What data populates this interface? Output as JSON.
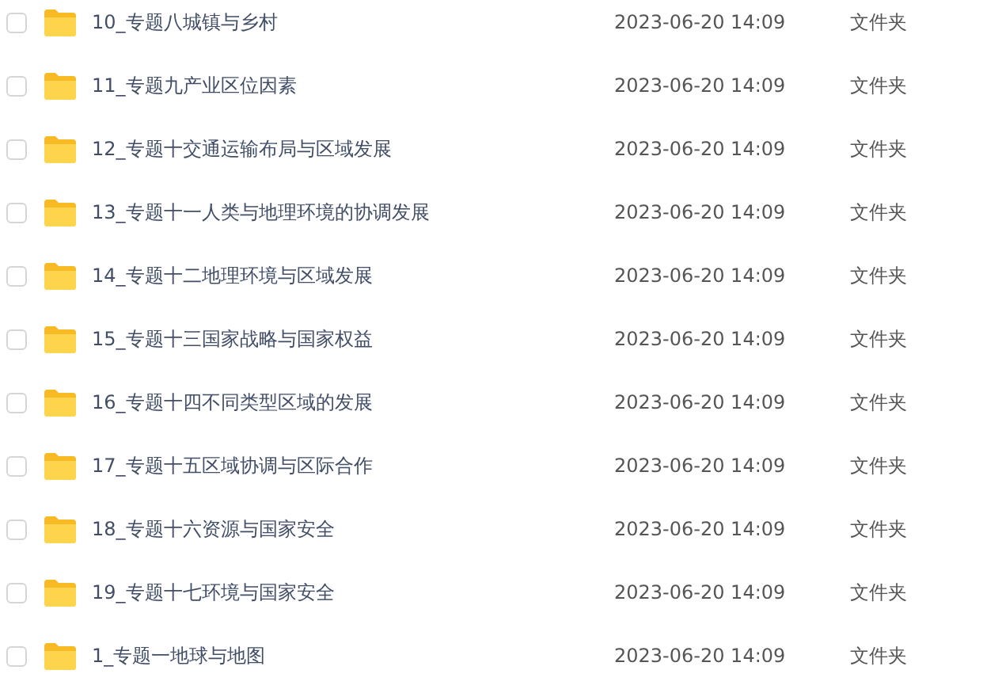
{
  "files": [
    {
      "name": "10_专题八城镇与乡村",
      "modified": "2023-06-20 14:09",
      "type": "文件夹",
      "checked": false
    },
    {
      "name": "11_专题九产业区位因素",
      "modified": "2023-06-20 14:09",
      "type": "文件夹",
      "checked": false
    },
    {
      "name": "12_专题十交通运输布局与区域发展",
      "modified": "2023-06-20 14:09",
      "type": "文件夹",
      "checked": false
    },
    {
      "name": "13_专题十一人类与地理环境的协调发展",
      "modified": "2023-06-20 14:09",
      "type": "文件夹",
      "checked": false
    },
    {
      "name": "14_专题十二地理环境与区域发展",
      "modified": "2023-06-20 14:09",
      "type": "文件夹",
      "checked": false
    },
    {
      "name": "15_专题十三国家战略与国家权益",
      "modified": "2023-06-20 14:09",
      "type": "文件夹",
      "checked": false
    },
    {
      "name": "16_专题十四不同类型区域的发展",
      "modified": "2023-06-20 14:09",
      "type": "文件夹",
      "checked": false
    },
    {
      "name": "17_专题十五区域协调与区际合作",
      "modified": "2023-06-20 14:09",
      "type": "文件夹",
      "checked": false
    },
    {
      "name": "18_专题十六资源与国家安全",
      "modified": "2023-06-20 14:09",
      "type": "文件夹",
      "checked": false
    },
    {
      "name": "19_专题十七环境与国家安全",
      "modified": "2023-06-20 14:09",
      "type": "文件夹",
      "checked": false
    },
    {
      "name": "1_专题一地球与地图",
      "modified": "2023-06-20 14:09",
      "type": "文件夹",
      "checked": false
    }
  ]
}
